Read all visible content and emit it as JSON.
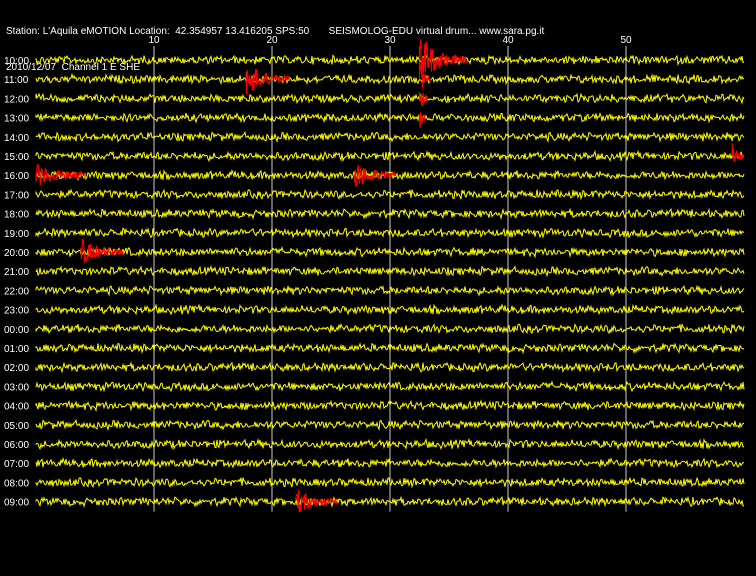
{
  "header": {
    "line1": "Station: L'Aquila eMOTION Location:  42.354957 13.416205 SPS:50       SEISMOLOG-EDU virtual drum... www.sara.pg.it",
    "line2": "2010/12/07  Channel 1 E SHE"
  },
  "colors": {
    "background": "#000000",
    "trace": "#ffff00",
    "event": "#ff0000",
    "grid": "#ffffff",
    "text": "#ffffff"
  },
  "chart_data": {
    "type": "line",
    "title": "",
    "x_label": "",
    "y_label": "",
    "x_range": [
      0,
      60
    ],
    "x_ticks": [
      10,
      20,
      30,
      40,
      50
    ],
    "rows": [
      "10:00",
      "11:00",
      "12:00",
      "13:00",
      "14:00",
      "15:00",
      "16:00",
      "17:00",
      "18:00",
      "19:00",
      "20:00",
      "21:00",
      "22:00",
      "23:00",
      "00:00",
      "01:00",
      "02:00",
      "03:00",
      "04:00",
      "05:00",
      "06:00",
      "07:00",
      "08:00",
      "09:00"
    ],
    "trace_row_count": 24,
    "events": [
      {
        "row": "10:00",
        "start_min": 32.5,
        "end_min": 36.5,
        "strength": 3.5
      },
      {
        "row": "11:00",
        "start_min": 17.8,
        "end_min": 21.5,
        "strength": 2.2
      },
      {
        "row": "11:00",
        "start_min": 32.5,
        "end_min": 33.5,
        "strength": 2.5
      },
      {
        "row": "12:00",
        "start_min": 32.5,
        "end_min": 33.2,
        "strength": 2.0
      },
      {
        "row": "13:00",
        "start_min": 32.5,
        "end_min": 33.0,
        "strength": 1.8
      },
      {
        "row": "15:00",
        "start_min": 59.0,
        "end_min": 60.0,
        "strength": 1.2
      },
      {
        "row": "16:00",
        "start_min": 0.0,
        "end_min": 4.2,
        "strength": 1.0
      },
      {
        "row": "16:00",
        "start_min": 27.0,
        "end_min": 30.5,
        "strength": 1.6
      },
      {
        "row": "20:00",
        "start_min": 3.8,
        "end_min": 7.5,
        "strength": 1.4
      },
      {
        "row": "09:00",
        "start_min": 22.0,
        "end_min": 25.5,
        "strength": 1.3
      }
    ]
  }
}
